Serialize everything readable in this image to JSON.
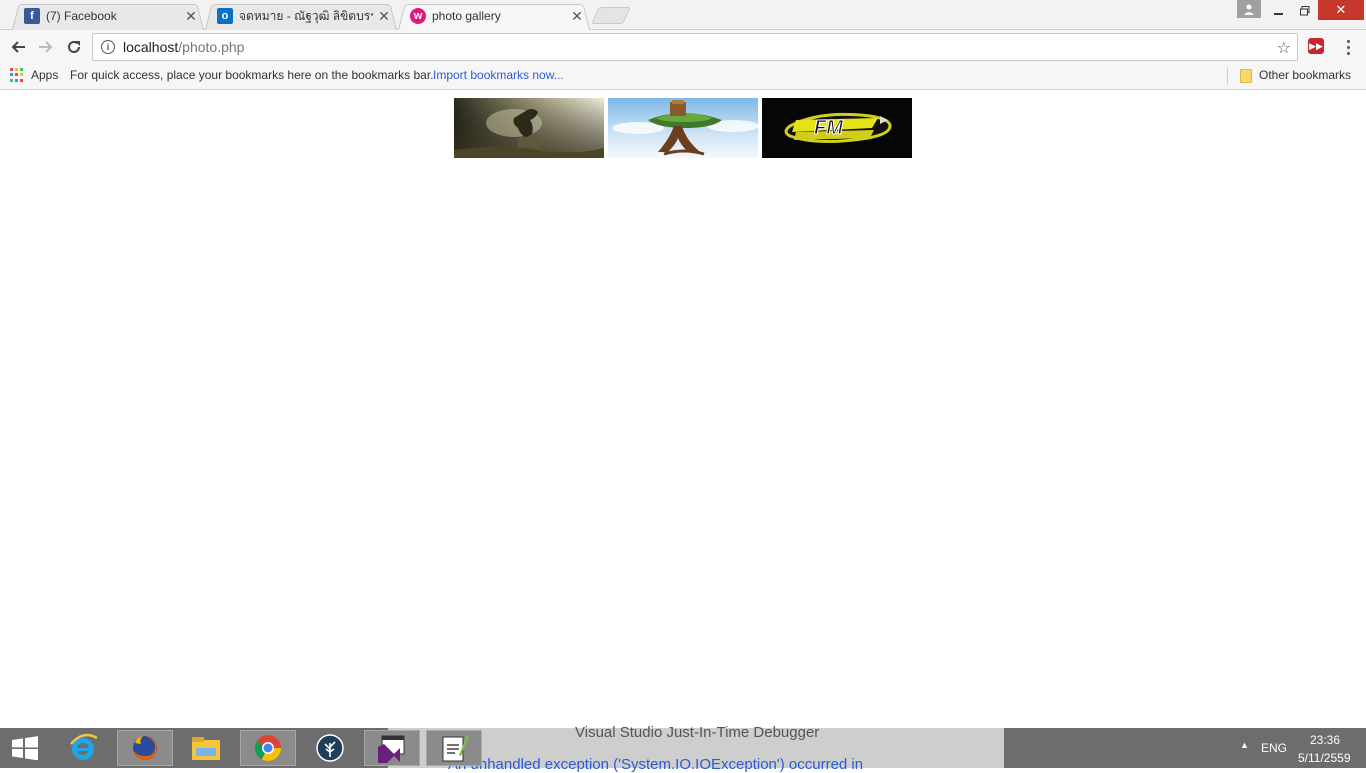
{
  "tabs": [
    {
      "title": "(7) Facebook",
      "icon": "facebook-icon",
      "color": "#3b5998",
      "active": false
    },
    {
      "title": "จดหมาย - ณัฐวุฒิ ลิขิตบรรณ",
      "icon": "outlook-icon",
      "color": "#0a72c6",
      "active": false
    },
    {
      "title": "photo gallery",
      "icon": "wampserver-icon",
      "color": "#e0197a",
      "active": true
    }
  ],
  "toolbar": {
    "url_host": "localhost",
    "url_path": "/photo.php"
  },
  "bookmarks": {
    "apps_label": "Apps",
    "hint": "For quick access, place your bookmarks here on the bookmarks bar.",
    "import_link": "Import bookmarks now...",
    "other": "Other bookmarks"
  },
  "gallery": {
    "images": [
      {
        "name": "warrior-on-rock-thumbnail",
        "alt": "sepia fantasy figure"
      },
      {
        "name": "tree-island-thumbnail",
        "alt": "floating tree island"
      },
      {
        "name": "fm-logo-thumbnail",
        "alt": "FM logo"
      }
    ]
  },
  "taskbar": {
    "overlay_title": "Visual Studio Just-In-Time Debugger",
    "overlay_message": "An unhandled exception ('System.IO.IOException') occurred in",
    "lang": "ENG",
    "time": "23:36",
    "date": "5/11/2559"
  },
  "colors": {
    "close_button": "#c7372b",
    "link": "#2a5bd7",
    "taskbar": "#6d6d6d"
  }
}
